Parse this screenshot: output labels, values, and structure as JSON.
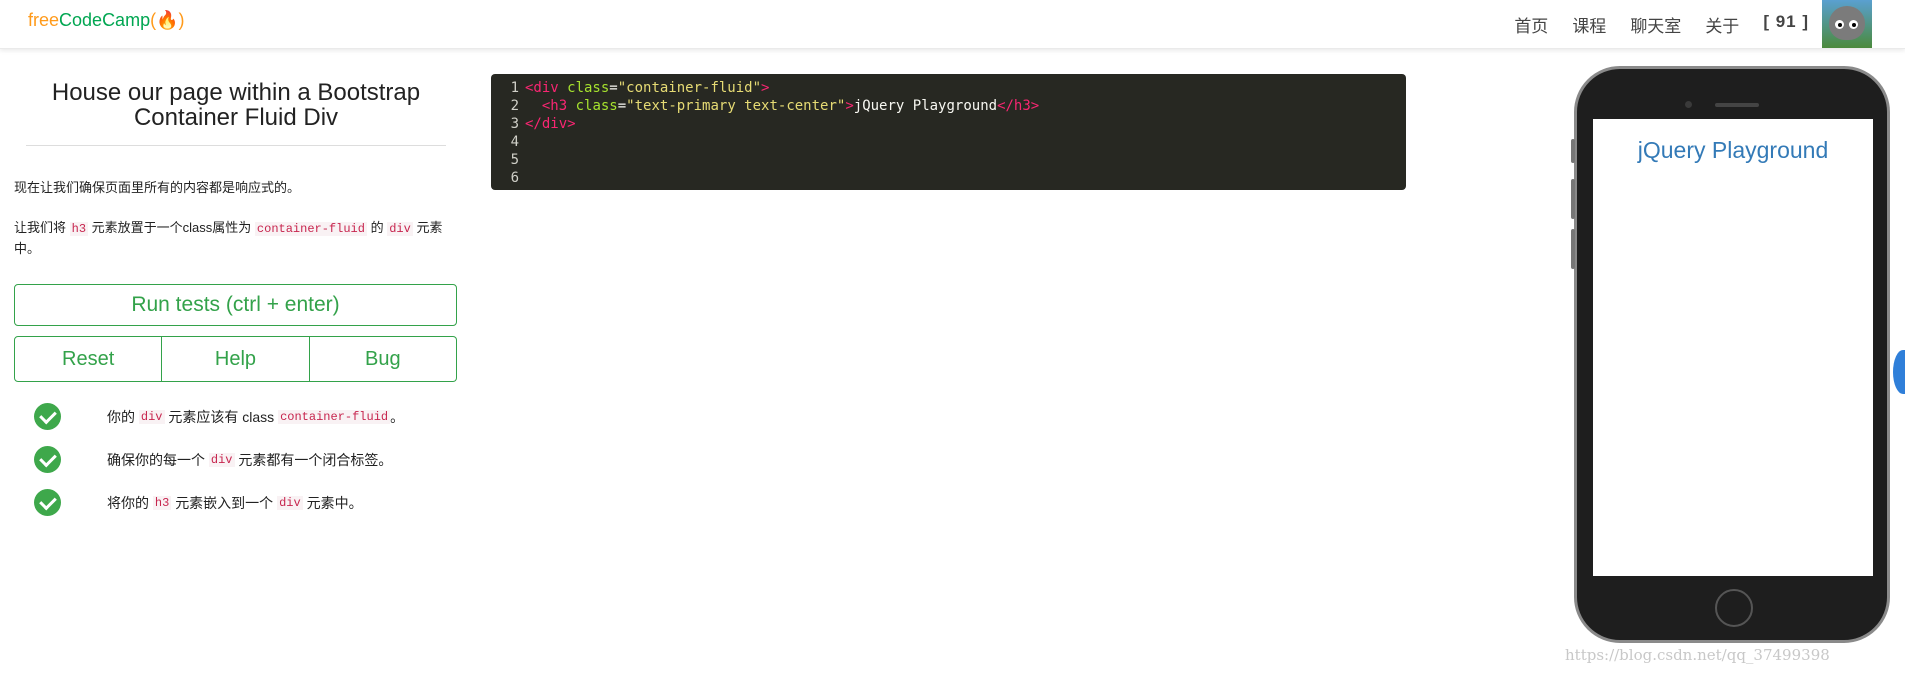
{
  "nav": {
    "brand_free": "free",
    "brand_code": "CodeCamp",
    "brand_icon": "(🔥)",
    "links": [
      "首页",
      "课程",
      "聊天室",
      "关于"
    ],
    "count": "[ 91 ]"
  },
  "challenge": {
    "title": "House our page within a Bootstrap Container Fluid Div",
    "intro": "现在让我们确保页面里所有的内容都是响应式的。",
    "instr_pre": "让我们将",
    "instr_code1": "h3",
    "instr_mid": "元素放置于一个class属性为",
    "instr_code2": "container-fluid",
    "instr_post": "的",
    "instr_code3": "div",
    "instr_end": "元素中。"
  },
  "buttons": {
    "run": "Run tests (ctrl + enter)",
    "reset": "Reset",
    "help": "Help",
    "bug": "Bug"
  },
  "tests": [
    {
      "pre": "你的",
      "c1": "div",
      "mid": "元素应该有 class",
      "c2": "container-fluid",
      "post": "。"
    },
    {
      "pre": "确保你的每一个",
      "c1": "div",
      "mid": "元素都有一个闭合标签。",
      "c2": "",
      "post": ""
    },
    {
      "pre": "将你的",
      "c1": "h3",
      "mid": "元素嵌入到一个",
      "c2": "div",
      "post": "元素中。"
    }
  ],
  "editor": {
    "line_numbers": [
      "1",
      "2",
      "3",
      "4",
      "5",
      "6"
    ],
    "l1_tag": "<div",
    "l1_attr": " class",
    "l1_eq": "=",
    "l1_str": "\"container-fluid\"",
    "l1_close": ">",
    "l2_indent": "  ",
    "l2_tag": "<h3",
    "l2_attr": " class",
    "l2_eq": "=",
    "l2_str": "\"text-primary text-center\"",
    "l2_gt": ">",
    "l2_text": "jQuery Playground",
    "l2_end": "</h3>",
    "l3_tag": "</div>"
  },
  "preview": {
    "heading": "jQuery Playground",
    "heading_color": "#337ab7"
  },
  "watermark": "https://blog.csdn.net/qq_37499398"
}
